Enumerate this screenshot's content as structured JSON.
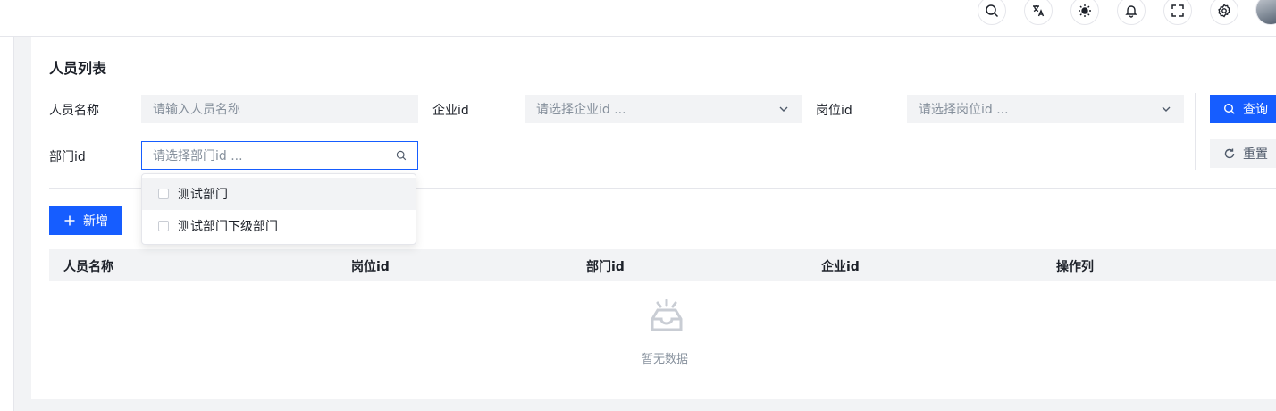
{
  "topbar": {
    "icons": [
      "search-icon",
      "translate-icon",
      "theme-sun-icon",
      "bell-icon",
      "fullscreen-icon",
      "settings-icon"
    ]
  },
  "card": {
    "title": "人员列表"
  },
  "filters": {
    "name_label": "人员名称",
    "name_placeholder": "请输入人员名称",
    "company_label": "企业id",
    "company_placeholder": "请选择企业id ...",
    "post_label": "岗位id",
    "post_placeholder": "请选择岗位id ...",
    "dept_label": "部门id",
    "dept_placeholder": "请选择部门id ..."
  },
  "buttons": {
    "query": "查询",
    "reset": "重置",
    "add": "新增"
  },
  "dropdown": {
    "options": [
      "测试部门",
      "测试部门下级部门"
    ]
  },
  "table": {
    "columns": [
      "人员名称",
      "岗位id",
      "部门id",
      "企业id",
      "操作列"
    ],
    "empty_text": "暂无数据"
  },
  "colors": {
    "primary": "#165dff",
    "fill": "#f2f3f5",
    "border": "#e5e6eb"
  }
}
